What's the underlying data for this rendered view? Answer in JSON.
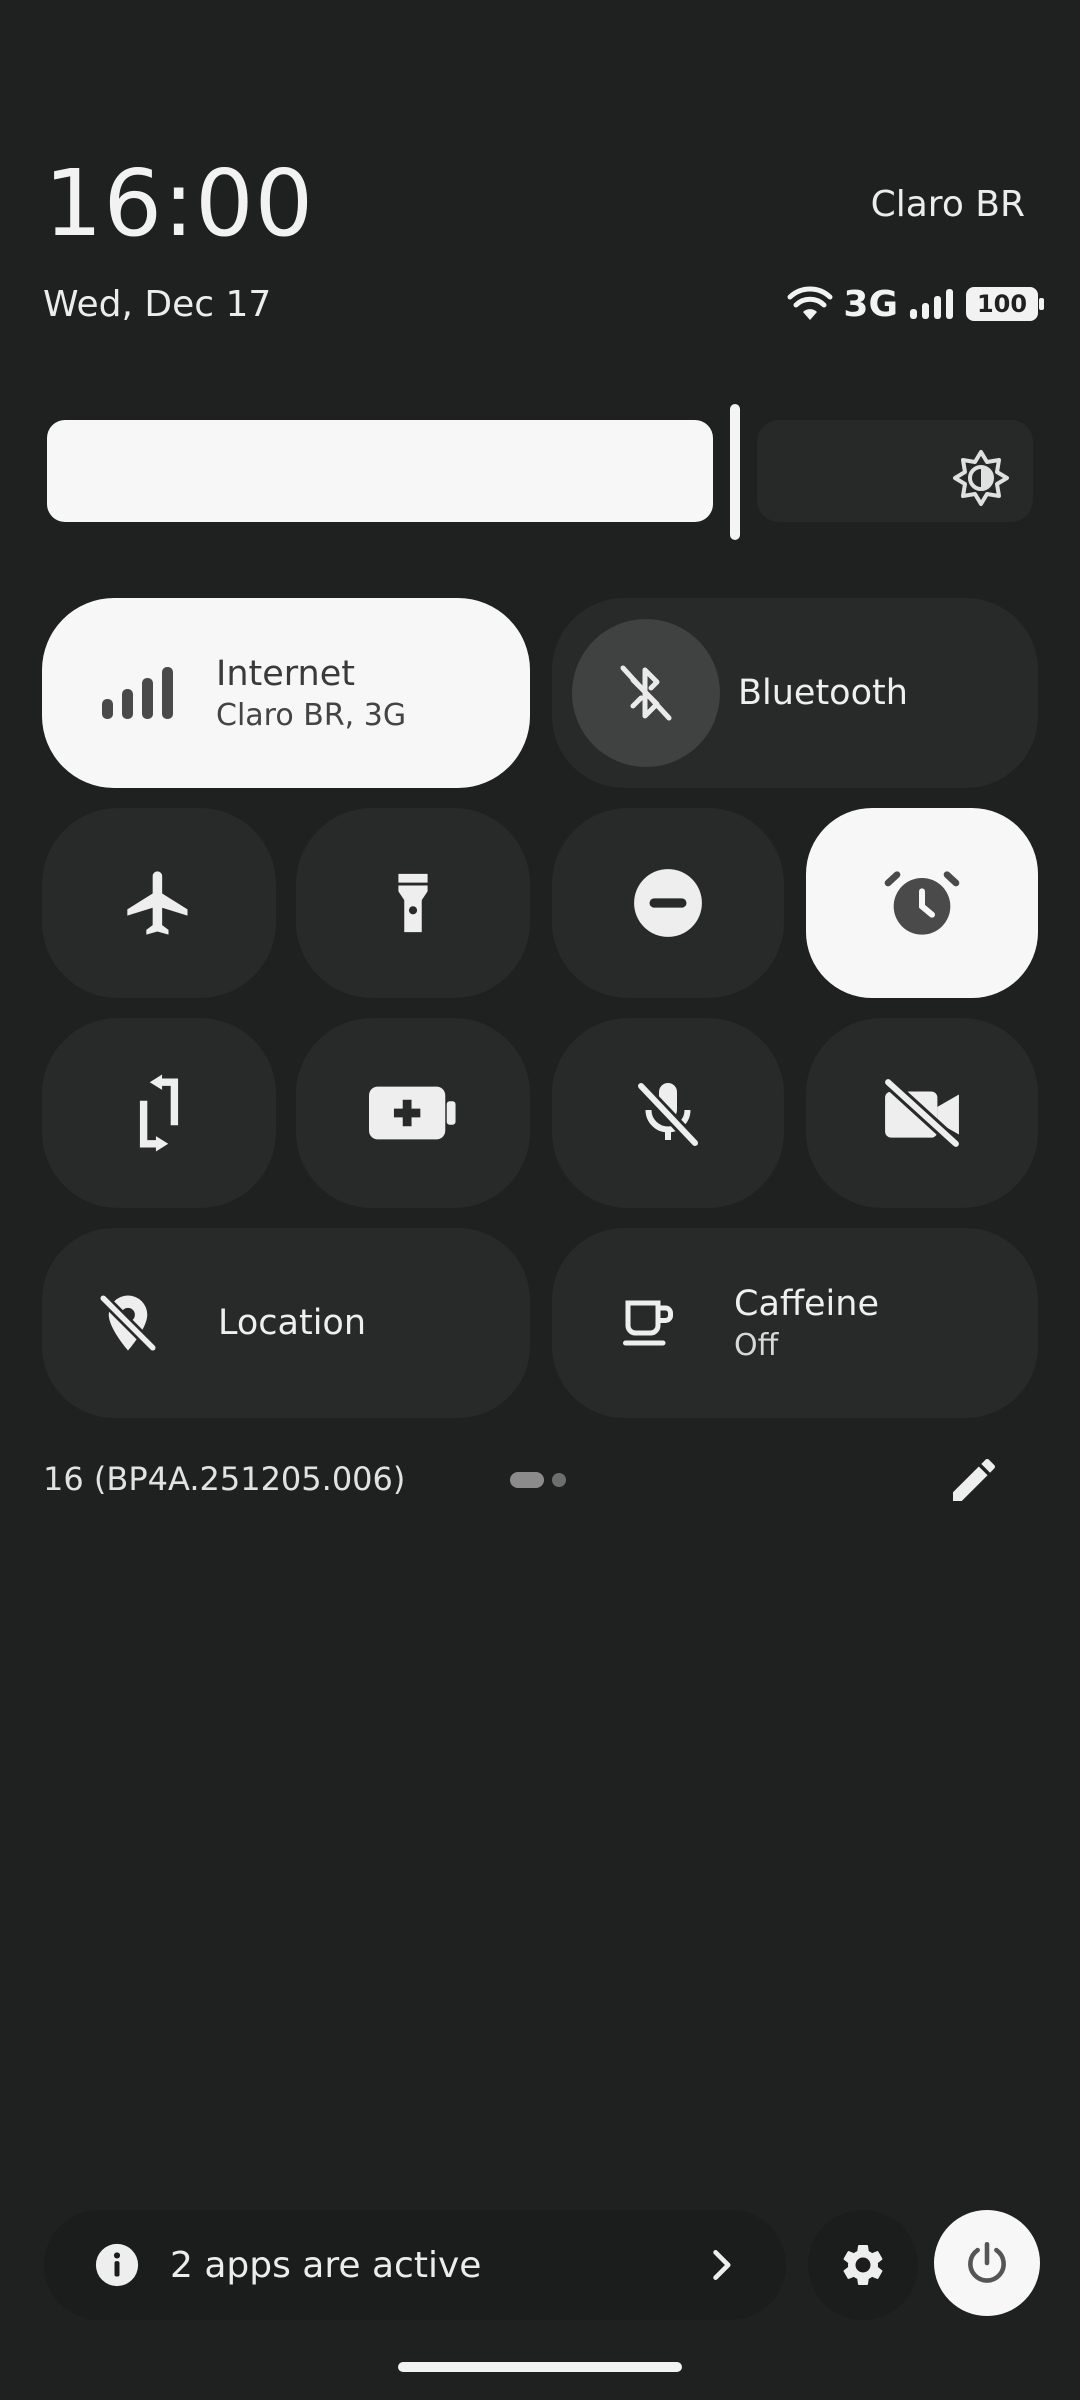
{
  "status": {
    "time": "16:00",
    "date": "Wed, Dec 17",
    "carrier": "Claro BR",
    "network_type": "3G",
    "battery_level": "100"
  },
  "brightness": {
    "level": 0.59,
    "icon": "brightness-icon"
  },
  "tiles": {
    "internet": {
      "label": "Internet",
      "sub": "Claro BR, 3G",
      "active": true,
      "icon": "signal-bars-icon"
    },
    "bluetooth": {
      "label": "Bluetooth",
      "active": false,
      "icon": "bluetooth-off-icon"
    },
    "airplane": {
      "active": false,
      "icon": "airplane-icon"
    },
    "flashlight": {
      "active": false,
      "icon": "flashlight-icon"
    },
    "dnd": {
      "active": false,
      "icon": "do-not-disturb-icon"
    },
    "alarm": {
      "active": true,
      "icon": "alarm-icon"
    },
    "rotate": {
      "active": false,
      "icon": "auto-rotate-icon"
    },
    "battery_saver": {
      "active": false,
      "icon": "battery-saver-icon"
    },
    "mic": {
      "active": false,
      "icon": "mic-off-icon"
    },
    "camera": {
      "active": false,
      "icon": "camera-off-icon"
    },
    "location": {
      "label": "Location",
      "active": false,
      "icon": "location-off-icon"
    },
    "caffeine": {
      "label": "Caffeine",
      "sub": "Off",
      "active": false,
      "icon": "coffee-cup-icon"
    }
  },
  "footer": {
    "build": "16 (BP4A.251205.006)",
    "page_indicator": {
      "pages": 2,
      "current": 1
    }
  },
  "bottom": {
    "apps_active": "2 apps are active"
  },
  "colors": {
    "background": "#1f2020",
    "tile_off": "#282929",
    "tile_on": "#f7f7f7"
  }
}
